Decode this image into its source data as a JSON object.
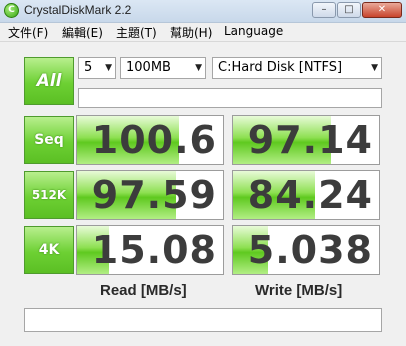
{
  "window": {
    "title": "CrystalDiskMark 2.2",
    "icon_glyph": "C",
    "buttons": {
      "minimize": "–",
      "maximize": "□",
      "close": "✕"
    }
  },
  "menu": [
    "文件(F)",
    "編輯(E)",
    "主題(T)",
    "幫助(H)",
    "Language"
  ],
  "controls": {
    "all_button": "All",
    "test_count": "5",
    "test_size": "100MB",
    "drive": "C:Hard Disk [NTFS]",
    "comment": "",
    "status": ""
  },
  "tests": [
    {
      "label": "Seq",
      "read": "100.6",
      "write": "97.14",
      "read_fill": 0.7,
      "write_fill": 0.67
    },
    {
      "label": "512K",
      "read": "97.59",
      "write": "84.24",
      "read_fill": 0.68,
      "write_fill": 0.56
    },
    {
      "label": "4K",
      "read": "15.08",
      "write": "5.038",
      "read_fill": 0.22,
      "write_fill": 0.24
    }
  ],
  "columns": {
    "read": "Read [MB/s]",
    "write": "Write [MB/s]"
  },
  "colors": {
    "accent_green": "#6dd033",
    "bar_green": "#5fc91f"
  }
}
